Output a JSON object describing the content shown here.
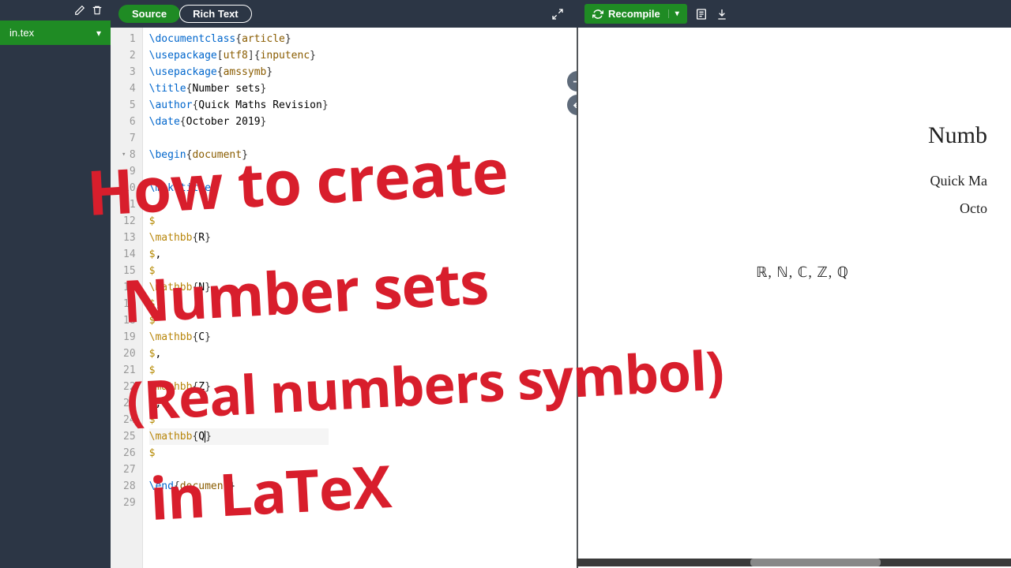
{
  "sidebar": {
    "file": "in.tex"
  },
  "toolbar": {
    "source": "Source",
    "richtext": "Rich Text"
  },
  "recompile": {
    "label": "Recompile"
  },
  "code": {
    "lines": [
      {
        "n": 1,
        "html": "<span class='tok-cmd'>\\documentclass</span><span class='tok-brace'>{</span><span class='tok-arg'>article</span><span class='tok-brace'>}</span>"
      },
      {
        "n": 2,
        "html": "<span class='tok-cmd'>\\usepackage</span><span class='tok-brace'>[</span><span class='tok-opt'>utf8</span><span class='tok-brace'>]{</span><span class='tok-arg'>inputenc</span><span class='tok-brace'>}</span>"
      },
      {
        "n": 3,
        "html": "<span class='tok-cmd'>\\usepackage</span><span class='tok-brace'>{</span><span class='tok-arg'>amssymb</span><span class='tok-brace'>}</span>"
      },
      {
        "n": 4,
        "html": "<span class='tok-cmd'>\\title</span><span class='tok-brace'>{</span>Number sets<span class='tok-brace'>}</span>"
      },
      {
        "n": 5,
        "html": "<span class='tok-cmd'>\\author</span><span class='tok-brace'>{</span>Quick Maths Revision<span class='tok-brace'>}</span>"
      },
      {
        "n": 6,
        "html": "<span class='tok-cmd'>\\date</span><span class='tok-brace'>{</span>October 2019<span class='tok-brace'>}</span>"
      },
      {
        "n": 7,
        "html": ""
      },
      {
        "n": 8,
        "fold": true,
        "html": "<span class='tok-cmd'>\\begin</span><span class='tok-brace'>{</span><span class='tok-arg'>document</span><span class='tok-brace'>}</span>"
      },
      {
        "n": 9,
        "html": ""
      },
      {
        "n": 10,
        "html": "<span class='tok-cmd'>\\maketitle</span>"
      },
      {
        "n": 11,
        "html": ""
      },
      {
        "n": 12,
        "html": "<span class='tok-math'>$</span>"
      },
      {
        "n": 13,
        "html": "<span class='tok-mb'>\\mathbb</span><span class='tok-brace'>{</span>R<span class='tok-brace'>}</span>"
      },
      {
        "n": 14,
        "html": "<span class='tok-math'>$</span>,"
      },
      {
        "n": 15,
        "html": "<span class='tok-math'>$</span>"
      },
      {
        "n": 16,
        "html": "<span class='tok-mb'>\\mathbb</span><span class='tok-brace'>{</span>N<span class='tok-brace'>}</span>"
      },
      {
        "n": 17,
        "html": "<span class='tok-math'>$</span>,"
      },
      {
        "n": 18,
        "html": "<span class='tok-math'>$</span>"
      },
      {
        "n": 19,
        "html": "<span class='tok-mb'>\\mathbb</span><span class='tok-brace'>{</span>C<span class='tok-brace'>}</span>"
      },
      {
        "n": 20,
        "html": "<span class='tok-math'>$</span>,"
      },
      {
        "n": 21,
        "html": "<span class='tok-math'>$</span>"
      },
      {
        "n": 22,
        "html": "<span class='tok-mb'>\\mathbb</span><span class='tok-brace'>{</span>Z<span class='tok-brace'>}</span>"
      },
      {
        "n": 23,
        "html": "<span class='tok-math'>$</span>,"
      },
      {
        "n": 24,
        "html": "<span class='tok-math'>$</span>"
      },
      {
        "n": 25,
        "hl": true,
        "html": "<span class='tok-mb'>\\mathbb</span><span class='tok-brace'>{</span>Q<span class='caret'></span><span class='tok-brace'>}</span>"
      },
      {
        "n": 26,
        "html": "<span class='tok-math'>$</span>"
      },
      {
        "n": 27,
        "html": ""
      },
      {
        "n": 28,
        "html": "<span class='tok-cmd'>\\end</span><span class='tok-brace'>{</span><span class='tok-arg'>document</span><span class='tok-brace'>}</span>"
      },
      {
        "n": 29,
        "html": ""
      }
    ]
  },
  "pdf": {
    "title": "Numb",
    "author": "Quick Ma",
    "date": "Octo",
    "sets": "ℝ, ℕ, ℂ, ℤ, ℚ"
  },
  "overlay": {
    "l1": "How to create",
    "l2": "Number sets",
    "l3": "(Real numbers symbol)",
    "l4": "in LaTeX"
  }
}
